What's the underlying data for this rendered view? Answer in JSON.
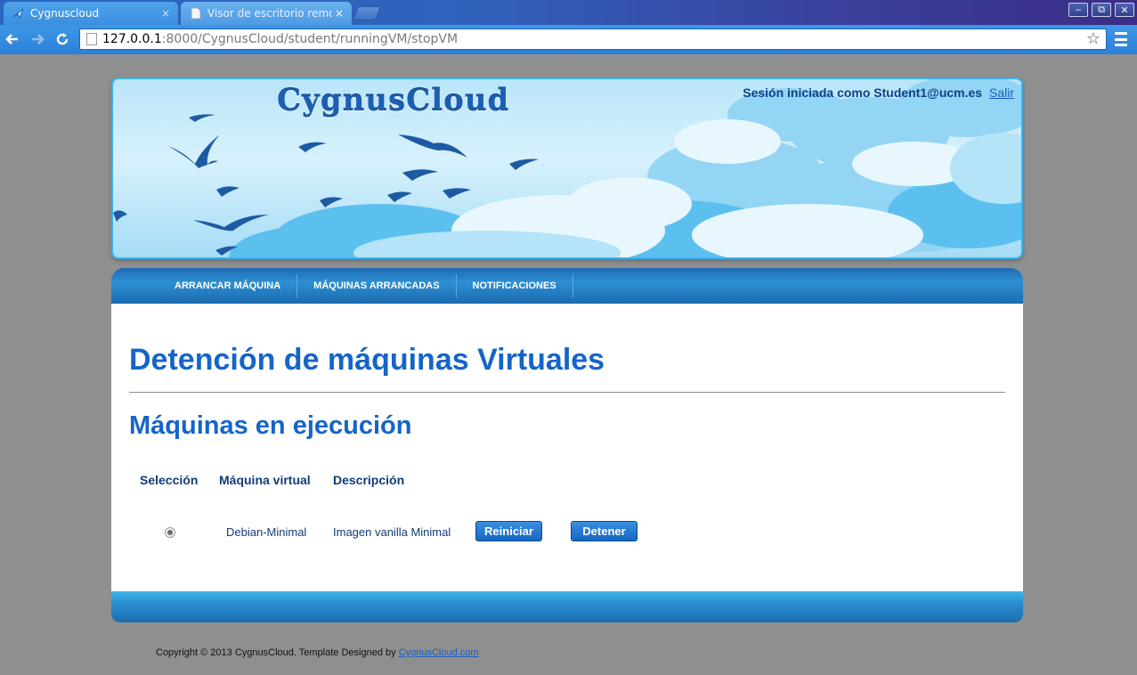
{
  "browser": {
    "tabs": [
      {
        "title": "Cygnuscloud",
        "close": "×"
      },
      {
        "title": "Visor de escritorio remoto",
        "close": "×"
      }
    ],
    "url_host": "127.0.0.1",
    "url_path": ":8000/CygnusCloud/student/runningVM/stopVM",
    "window_controls": {
      "minimize": "–",
      "maximize": "⧉",
      "close": "✕"
    },
    "icons": {
      "back": "back-arrow-icon",
      "forward": "forward-arrow-icon",
      "reload": "reload-icon",
      "bookmark": "star-icon",
      "menu": "hamburger-menu-icon"
    }
  },
  "header": {
    "logo": "CygnusCloud",
    "session_text": "Sesión iniciada como Student1@ucm.es",
    "logout_label": "Salir"
  },
  "nav": {
    "items": [
      "ARRANCAR MÁQUINA",
      "MÁQUINAS ARRANCADAS",
      "NOTIFICACIONES"
    ]
  },
  "main": {
    "title": "Detención de máquinas Virtuales",
    "subtitle": "Máquinas en ejecución",
    "table": {
      "headers": [
        "Selección",
        "Máquina virtual",
        "Descripción"
      ],
      "rows": [
        {
          "name": "Debian-Minimal",
          "description": "Imagen vanilla Minimal",
          "selected": true
        }
      ]
    },
    "restart_label": "Reiniciar",
    "stop_label": "Detener"
  },
  "footer": {
    "copyright": "Copyright © 2013 CygnusCloud. Template Designed by",
    "link": "CygnusCloud.com"
  },
  "colors": {
    "heading": "#1565c8",
    "nav_bar": "#1d6bb3",
    "button": "#1667c1",
    "page_bg": "#8f8f8f"
  }
}
